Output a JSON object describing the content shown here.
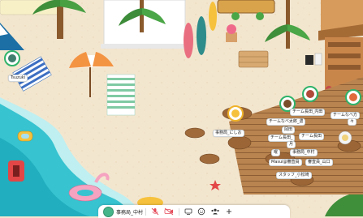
{
  "players": {
    "tsuzuki": "Tsuzuki",
    "p1": "チーム長田_内田",
    "p2": "チームなべ太郎_濃",
    "p3": "チームなべ方",
    "p4": "事務局_にしお",
    "p5": "岡田",
    "p6": "チーム長田",
    "p7": "チーム長田_",
    "p8": "月",
    "p9": "曜",
    "p10": "事務局_中村",
    "p11": "Masui@審査員",
    "p12": "審査員_山口",
    "p13": "スタッフ_小松崎",
    "p14": "々"
  },
  "toolbar": {
    "user_name": "事務局_中村"
  },
  "colors": {
    "sea": "#37c3d0",
    "sand": "#f2e5cd",
    "deck": "#b07a4a",
    "status_green": "#2fb36a",
    "muted_red": "#e44d5b"
  }
}
